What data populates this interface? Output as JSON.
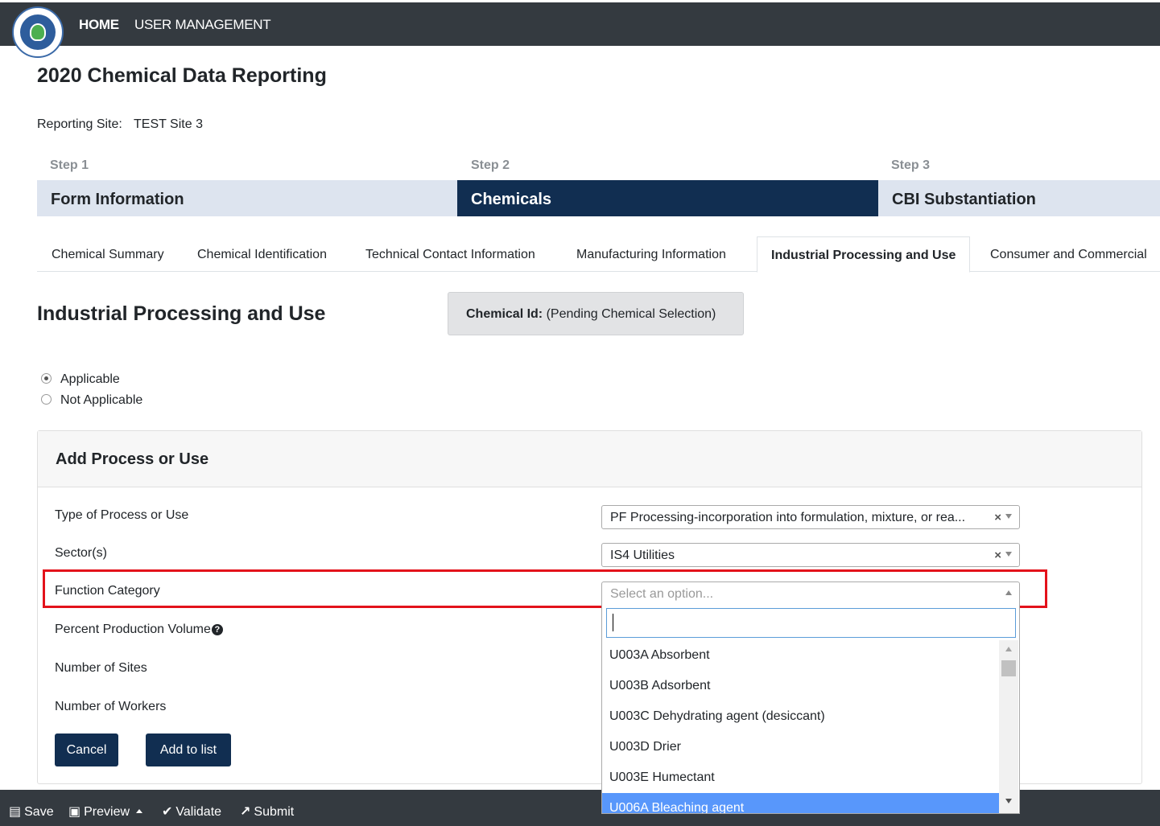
{
  "nav": {
    "home": "HOME",
    "user_management": "USER MANAGEMENT"
  },
  "page_title": "2020 Chemical Data Reporting",
  "reporting_site": {
    "label": "Reporting Site:",
    "value": "TEST Site 3"
  },
  "steps": [
    {
      "step": "Step 1",
      "name": "Form Information",
      "active": false
    },
    {
      "step": "Step 2",
      "name": "Chemicals",
      "active": true
    },
    {
      "step": "Step 3",
      "name": "CBI Substantiation",
      "active": false
    }
  ],
  "tabs": [
    {
      "label": "Chemical Summary",
      "active": false
    },
    {
      "label": "Chemical Identification",
      "active": false
    },
    {
      "label": "Technical Contact Information",
      "active": false
    },
    {
      "label": "Manufacturing Information",
      "active": false
    },
    {
      "label": "Industrial Processing and Use",
      "active": true
    },
    {
      "label": "Consumer and Commercial",
      "active": false
    }
  ],
  "section_title": "Industrial Processing and Use",
  "chemical_id": {
    "label": "Chemical Id:",
    "value": "(Pending Chemical Selection)"
  },
  "applicability": {
    "options": [
      "Applicable",
      "Not Applicable"
    ],
    "selected": "Applicable"
  },
  "card": {
    "title": "Add Process or Use",
    "fields": {
      "type_label": "Type of Process or Use",
      "type_value": "PF Processing-incorporation into formulation, mixture, or rea...",
      "sector_label": "Sector(s)",
      "sector_value": "IS4 Utilities",
      "function_label": "Function Category",
      "function_placeholder": "Select an option...",
      "percent_label": "Percent Production Volume",
      "sites_label": "Number of Sites",
      "workers_label": "Number of Workers"
    },
    "clear_symbol": "×",
    "help_symbol": "?",
    "buttons": {
      "cancel": "Cancel",
      "add": "Add to list"
    }
  },
  "dropdown": {
    "search_value": "",
    "options": [
      "U003A Absorbent",
      "U003B Adsorbent",
      "U003C Dehydrating agent (desiccant)",
      "U003D Drier",
      "U003E Humectant",
      "U006A Bleaching agent"
    ],
    "highlighted_index": 5
  },
  "bottom_bar": {
    "save": "Save",
    "preview": "Preview",
    "validate": "Validate",
    "submit": "Submit",
    "icons": {
      "save": "floppy-disk-icon",
      "preview": "camera-icon",
      "validate": "checkmark-icon",
      "submit": "external-link-icon"
    }
  },
  "colors": {
    "topbar": "#343a40",
    "step_active": "#112e51",
    "step_inactive": "#dde4ef",
    "highlight_box": "#e3121b",
    "option_highlight": "#5897fb"
  }
}
